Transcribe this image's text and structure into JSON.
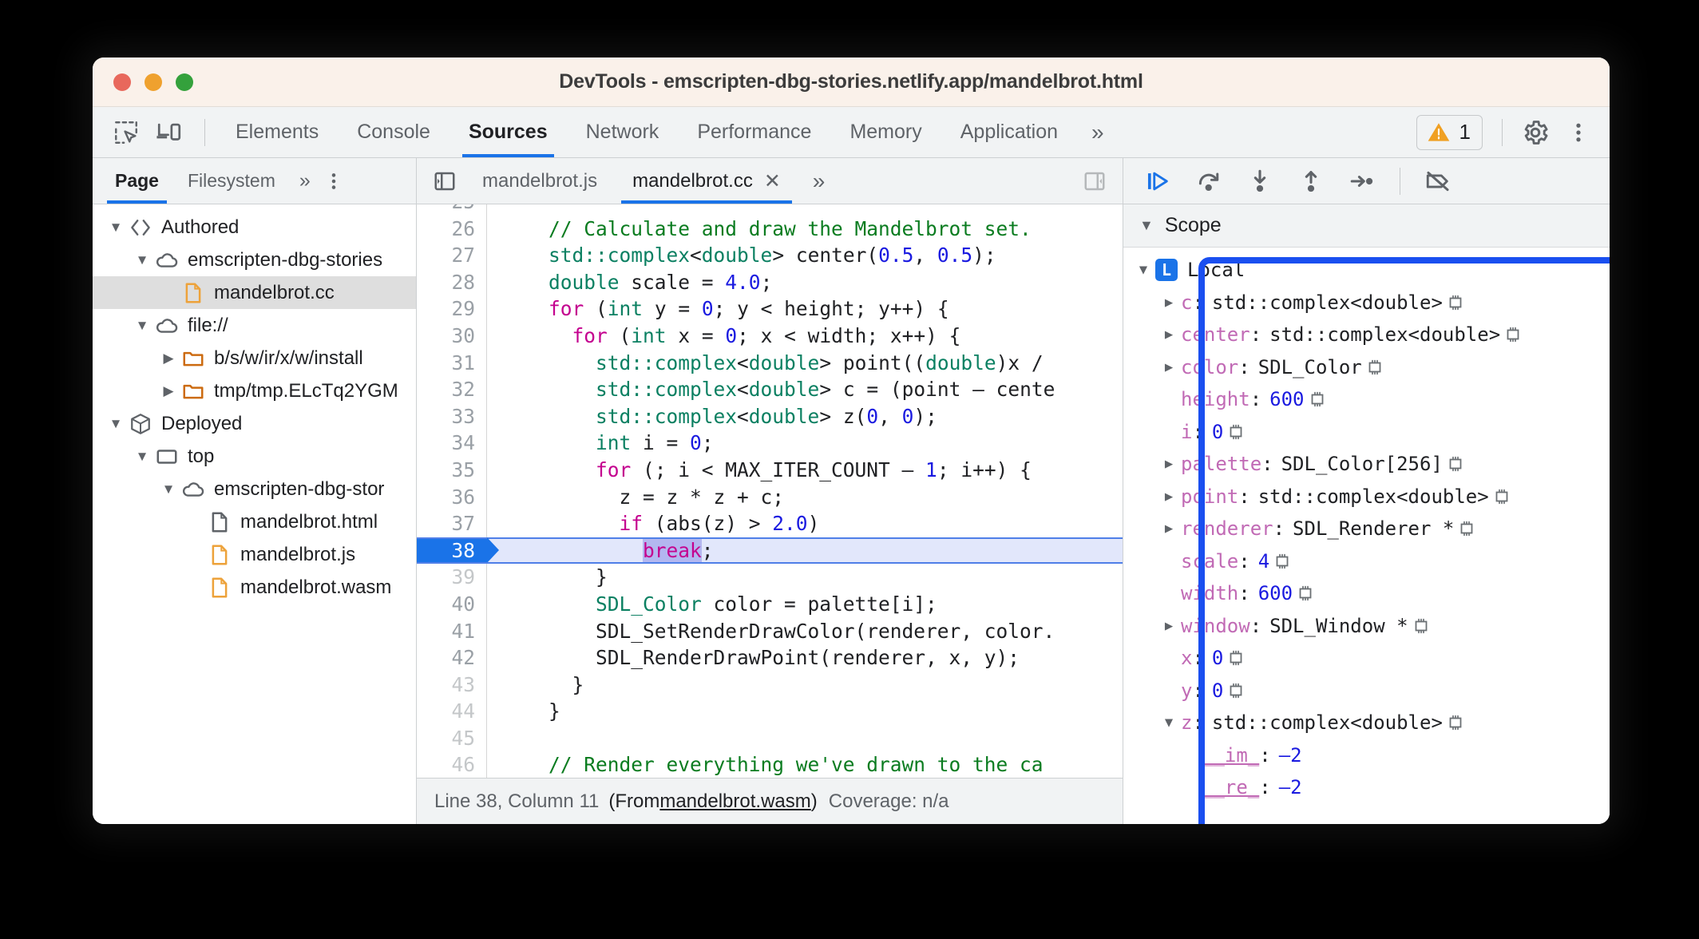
{
  "window": {
    "title": "DevTools - emscripten-dbg-stories.netlify.app/mandelbrot.html",
    "traffic": [
      "close-red",
      "minimize-yellow",
      "zoom-green"
    ]
  },
  "toolbar": {
    "inspect_icon": "inspect-element-icon",
    "device_icon": "device-toolbar-icon",
    "tabs": [
      {
        "label": "Elements",
        "active": false
      },
      {
        "label": "Console",
        "active": false
      },
      {
        "label": "Sources",
        "active": true
      },
      {
        "label": "Network",
        "active": false
      },
      {
        "label": "Performance",
        "active": false
      },
      {
        "label": "Memory",
        "active": false
      },
      {
        "label": "Application",
        "active": false
      }
    ],
    "more_tabs": "»",
    "warning_count": "1",
    "warning_icon": "warning-triangle-icon",
    "settings_icon": "gear-icon",
    "menu_icon": "three-dots-vertical-icon"
  },
  "navigator": {
    "tabs": [
      {
        "label": "Page",
        "active": true
      },
      {
        "label": "Filesystem",
        "active": false
      }
    ],
    "more_tabs": "»",
    "menu_icon": "three-dots-vertical-icon",
    "tree": [
      {
        "label": "Authored",
        "indent": 0,
        "twisty": "open",
        "icon": "code-brackets-icon",
        "selected": false
      },
      {
        "label": "emscripten-dbg-stories",
        "indent": 1,
        "twisty": "open",
        "icon": "cloud-icon",
        "selected": false
      },
      {
        "label": "mandelbrot.cc",
        "indent": 2,
        "twisty": "none",
        "icon": "file-orange-icon",
        "selected": true
      },
      {
        "label": "file://",
        "indent": 1,
        "twisty": "open",
        "icon": "cloud-icon",
        "selected": false
      },
      {
        "label": "b/s/w/ir/x/w/install",
        "indent": 2,
        "twisty": "closed",
        "icon": "folder-orange-icon",
        "selected": false
      },
      {
        "label": "tmp/tmp.ELcTq2YGM",
        "indent": 2,
        "twisty": "closed",
        "icon": "folder-orange-icon",
        "selected": false
      },
      {
        "label": "Deployed",
        "indent": 0,
        "twisty": "open",
        "icon": "cube-icon",
        "selected": false
      },
      {
        "label": "top",
        "indent": 1,
        "twisty": "open",
        "icon": "frame-icon",
        "selected": false
      },
      {
        "label": "emscripten-dbg-stor",
        "indent": 2,
        "twisty": "open",
        "icon": "cloud-icon",
        "selected": false
      },
      {
        "label": "mandelbrot.html",
        "indent": 3,
        "twisty": "none",
        "icon": "file-grey-icon",
        "selected": false
      },
      {
        "label": "mandelbrot.js",
        "indent": 3,
        "twisty": "none",
        "icon": "file-orange-icon",
        "selected": false
      },
      {
        "label": "mandelbrot.wasm",
        "indent": 3,
        "twisty": "none",
        "icon": "file-orange-icon",
        "selected": false
      }
    ]
  },
  "editor": {
    "collapse_left_icon": "panel-collapse-left-icon",
    "expand_right_icon": "panel-expand-right-icon",
    "tabs": [
      {
        "label": "mandelbrot.js",
        "active": false,
        "closable": false
      },
      {
        "label": "mandelbrot.cc",
        "active": true,
        "closable": true
      }
    ],
    "close_glyph": "✕",
    "more_tabs": "»",
    "first_line": 25,
    "lines": [
      {
        "n": 25,
        "partial": true,
        "exec": false,
        "tokens": []
      },
      {
        "n": 26,
        "exec": false,
        "tokens": [
          {
            "t": "    ",
            "c": ""
          },
          {
            "t": "// Calculate and draw the Mandelbrot set.",
            "c": "tok-com"
          }
        ]
      },
      {
        "n": 27,
        "exec": false,
        "tokens": [
          {
            "t": "    ",
            "c": ""
          },
          {
            "t": "std::complex",
            "c": "tok-type"
          },
          {
            "t": "<",
            "c": ""
          },
          {
            "t": "double",
            "c": "tok-type"
          },
          {
            "t": "> center(",
            "c": ""
          },
          {
            "t": "0.5",
            "c": "tok-num"
          },
          {
            "t": ", ",
            "c": ""
          },
          {
            "t": "0.5",
            "c": "tok-num"
          },
          {
            "t": ");",
            "c": ""
          }
        ]
      },
      {
        "n": 28,
        "exec": false,
        "tokens": [
          {
            "t": "    ",
            "c": ""
          },
          {
            "t": "double",
            "c": "tok-type"
          },
          {
            "t": " scale = ",
            "c": ""
          },
          {
            "t": "4.0",
            "c": "tok-num"
          },
          {
            "t": ";",
            "c": ""
          }
        ]
      },
      {
        "n": 29,
        "exec": false,
        "tokens": [
          {
            "t": "    ",
            "c": ""
          },
          {
            "t": "for",
            "c": "tok-kw"
          },
          {
            "t": " (",
            "c": ""
          },
          {
            "t": "int",
            "c": "tok-type"
          },
          {
            "t": " y = ",
            "c": ""
          },
          {
            "t": "0",
            "c": "tok-num"
          },
          {
            "t": "; y < height; y++) {",
            "c": ""
          }
        ]
      },
      {
        "n": 30,
        "exec": false,
        "tokens": [
          {
            "t": "      ",
            "c": ""
          },
          {
            "t": "for",
            "c": "tok-kw"
          },
          {
            "t": " (",
            "c": ""
          },
          {
            "t": "int",
            "c": "tok-type"
          },
          {
            "t": " x = ",
            "c": ""
          },
          {
            "t": "0",
            "c": "tok-num"
          },
          {
            "t": "; x < width; x++) {",
            "c": ""
          }
        ]
      },
      {
        "n": 31,
        "exec": false,
        "tokens": [
          {
            "t": "        ",
            "c": ""
          },
          {
            "t": "std::complex",
            "c": "tok-type"
          },
          {
            "t": "<",
            "c": ""
          },
          {
            "t": "double",
            "c": "tok-type"
          },
          {
            "t": "> point((",
            "c": ""
          },
          {
            "t": "double",
            "c": "tok-type"
          },
          {
            "t": ")x /",
            "c": ""
          }
        ]
      },
      {
        "n": 32,
        "exec": false,
        "tokens": [
          {
            "t": "        ",
            "c": ""
          },
          {
            "t": "std::complex",
            "c": "tok-type"
          },
          {
            "t": "<",
            "c": ""
          },
          {
            "t": "double",
            "c": "tok-type"
          },
          {
            "t": "> c = (point – cente",
            "c": ""
          }
        ]
      },
      {
        "n": 33,
        "exec": false,
        "tokens": [
          {
            "t": "        ",
            "c": ""
          },
          {
            "t": "std::complex",
            "c": "tok-type"
          },
          {
            "t": "<",
            "c": ""
          },
          {
            "t": "double",
            "c": "tok-type"
          },
          {
            "t": "> z(",
            "c": ""
          },
          {
            "t": "0",
            "c": "tok-num"
          },
          {
            "t": ", ",
            "c": ""
          },
          {
            "t": "0",
            "c": "tok-num"
          },
          {
            "t": ");",
            "c": ""
          }
        ]
      },
      {
        "n": 34,
        "exec": false,
        "tokens": [
          {
            "t": "        ",
            "c": ""
          },
          {
            "t": "int",
            "c": "tok-type"
          },
          {
            "t": " i = ",
            "c": ""
          },
          {
            "t": "0",
            "c": "tok-num"
          },
          {
            "t": ";",
            "c": ""
          }
        ]
      },
      {
        "n": 35,
        "exec": false,
        "tokens": [
          {
            "t": "        ",
            "c": ""
          },
          {
            "t": "for",
            "c": "tok-kw"
          },
          {
            "t": " (; i < MAX_ITER_COUNT – ",
            "c": ""
          },
          {
            "t": "1",
            "c": "tok-num"
          },
          {
            "t": "; i++) {",
            "c": ""
          }
        ]
      },
      {
        "n": 36,
        "exec": false,
        "tokens": [
          {
            "t": "          z = z * z + c;",
            "c": ""
          }
        ]
      },
      {
        "n": 37,
        "exec": false,
        "tokens": [
          {
            "t": "          ",
            "c": ""
          },
          {
            "t": "if",
            "c": "tok-kw"
          },
          {
            "t": " (abs(z) > ",
            "c": ""
          },
          {
            "t": "2.0",
            "c": "tok-num"
          },
          {
            "t": ")",
            "c": ""
          }
        ]
      },
      {
        "n": 38,
        "exec": true,
        "tokens": [
          {
            "t": "            ",
            "c": ""
          },
          {
            "t": "break",
            "c": "tok-kw sel"
          },
          {
            "t": ";",
            "c": ""
          }
        ]
      },
      {
        "n": 39,
        "dim": true,
        "exec": false,
        "tokens": [
          {
            "t": "        }",
            "c": ""
          }
        ]
      },
      {
        "n": 40,
        "exec": false,
        "tokens": [
          {
            "t": "        ",
            "c": ""
          },
          {
            "t": "SDL_Color",
            "c": "tok-type"
          },
          {
            "t": " color = palette[i];",
            "c": ""
          }
        ]
      },
      {
        "n": 41,
        "exec": false,
        "tokens": [
          {
            "t": "        SDL_SetRenderDrawColor(renderer, color.",
            "c": ""
          }
        ]
      },
      {
        "n": 42,
        "exec": false,
        "tokens": [
          {
            "t": "        SDL_RenderDrawPoint(renderer, x, y);",
            "c": ""
          }
        ]
      },
      {
        "n": 43,
        "dim": true,
        "exec": false,
        "tokens": [
          {
            "t": "      }",
            "c": ""
          }
        ]
      },
      {
        "n": 44,
        "dim": true,
        "exec": false,
        "tokens": [
          {
            "t": "    }",
            "c": ""
          }
        ]
      },
      {
        "n": 45,
        "dim": true,
        "exec": false,
        "tokens": [
          {
            "t": "",
            "c": ""
          }
        ]
      },
      {
        "n": 46,
        "dim": true,
        "exec": false,
        "tokens": [
          {
            "t": "    ",
            "c": ""
          },
          {
            "t": "// Render everything we've drawn to the ca",
            "c": "tok-com"
          }
        ]
      }
    ],
    "status": {
      "position": "Line 38, Column 11",
      "from_label": "(From ",
      "from_file": "mandelbrot.wasm",
      "from_close": ")",
      "coverage": "Coverage: n/a"
    }
  },
  "debugger": {
    "buttons": [
      {
        "name": "resume-script-execution",
        "icon": "resume-icon",
        "primary": true
      },
      {
        "name": "step-over-next-call",
        "icon": "step-over-icon",
        "primary": false
      },
      {
        "name": "step-into-next-call",
        "icon": "step-into-icon",
        "primary": false
      },
      {
        "name": "step-out-of-current",
        "icon": "step-out-icon",
        "primary": false
      },
      {
        "name": "step",
        "icon": "step-icon",
        "primary": false
      },
      {
        "name": "deactivate-breakpoints",
        "icon": "breakpoint-off-icon",
        "primary": false
      }
    ],
    "scope": {
      "title": "Scope",
      "group": {
        "badge": "L",
        "label": "Local"
      },
      "vars": [
        {
          "name": "c",
          "value": "std::complex<double>",
          "expandable": true,
          "expanded": false,
          "indent": 1,
          "chip": true,
          "numeric": false,
          "prop": false
        },
        {
          "name": "center",
          "value": "std::complex<double>",
          "expandable": true,
          "expanded": false,
          "indent": 1,
          "chip": true,
          "numeric": false,
          "prop": false
        },
        {
          "name": "color",
          "value": "SDL_Color",
          "expandable": true,
          "expanded": false,
          "indent": 1,
          "chip": true,
          "numeric": false,
          "prop": false
        },
        {
          "name": "height",
          "value": "600",
          "expandable": false,
          "expanded": false,
          "indent": 1,
          "chip": true,
          "numeric": true,
          "prop": false
        },
        {
          "name": "i",
          "value": "0",
          "expandable": false,
          "expanded": false,
          "indent": 1,
          "chip": true,
          "numeric": true,
          "prop": false
        },
        {
          "name": "palette",
          "value": "SDL_Color[256]",
          "expandable": true,
          "expanded": false,
          "indent": 1,
          "chip": true,
          "numeric": false,
          "prop": false
        },
        {
          "name": "point",
          "value": "std::complex<double>",
          "expandable": true,
          "expanded": false,
          "indent": 1,
          "chip": true,
          "numeric": false,
          "prop": false
        },
        {
          "name": "renderer",
          "value": "SDL_Renderer *",
          "expandable": true,
          "expanded": false,
          "indent": 1,
          "chip": true,
          "numeric": false,
          "prop": false
        },
        {
          "name": "scale",
          "value": "4",
          "expandable": false,
          "expanded": false,
          "indent": 1,
          "chip": true,
          "numeric": true,
          "prop": false
        },
        {
          "name": "width",
          "value": "600",
          "expandable": false,
          "expanded": false,
          "indent": 1,
          "chip": true,
          "numeric": true,
          "prop": false
        },
        {
          "name": "window",
          "value": "SDL_Window *",
          "expandable": true,
          "expanded": false,
          "indent": 1,
          "chip": true,
          "numeric": false,
          "prop": false
        },
        {
          "name": "x",
          "value": "0",
          "expandable": false,
          "expanded": false,
          "indent": 1,
          "chip": true,
          "numeric": true,
          "prop": false
        },
        {
          "name": "y",
          "value": "0",
          "expandable": false,
          "expanded": false,
          "indent": 1,
          "chip": true,
          "numeric": true,
          "prop": false
        },
        {
          "name": "z",
          "value": "std::complex<double>",
          "expandable": true,
          "expanded": true,
          "indent": 1,
          "chip": true,
          "numeric": false,
          "prop": false
        },
        {
          "name": "__im_",
          "value": "–2",
          "expandable": false,
          "expanded": false,
          "indent": 2,
          "chip": false,
          "numeric": true,
          "prop": true
        },
        {
          "name": "__re_",
          "value": "–2",
          "expandable": false,
          "expanded": false,
          "indent": 2,
          "chip": false,
          "numeric": true,
          "prop": true
        }
      ]
    }
  },
  "colors": {
    "accent": "#1a73e8",
    "highlight_frame": "#1a4ff0",
    "warning": "#f0a023",
    "titlebar": "#faf1ea",
    "toolbar": "#f1f3f4"
  }
}
